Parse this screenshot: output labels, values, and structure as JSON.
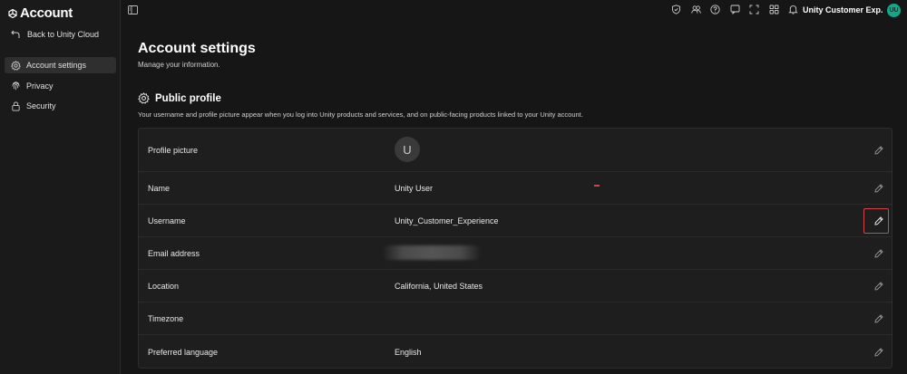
{
  "brand": {
    "title": "Account"
  },
  "sidebar": {
    "back_label": "Back to Unity Cloud",
    "items": [
      {
        "label": "Account settings",
        "icon": "gear-icon",
        "active": true
      },
      {
        "label": "Privacy",
        "icon": "fingerprint-icon",
        "active": false
      },
      {
        "label": "Security",
        "icon": "lock-icon",
        "active": false
      }
    ]
  },
  "topbar": {
    "icons": [
      "shield-icon",
      "people-icon",
      "help-icon",
      "chat-icon",
      "fullscreen-icon",
      "apps-grid-icon",
      "bell-icon"
    ],
    "org_name": "Unity Customer Exp...",
    "avatar_initials": "UU",
    "avatar_color": "#14a88a"
  },
  "page": {
    "title": "Account settings",
    "subtitle": "Manage your information."
  },
  "public_profile": {
    "title": "Public profile",
    "description": "Your username and profile picture appear when you log into Unity products and services, and on public-facing products linked to your Unity account.",
    "rows": [
      {
        "label": "Profile picture",
        "value": "",
        "avatar_letter": "U"
      },
      {
        "label": "Name",
        "value": "Unity User"
      },
      {
        "label": "Username",
        "value": "Unity_Customer_Experience"
      },
      {
        "label": "Email address",
        "value": ""
      },
      {
        "label": "Location",
        "value": "California, United States"
      },
      {
        "label": "Timezone",
        "value": ""
      },
      {
        "label": "Preferred language",
        "value": "English"
      }
    ]
  },
  "colors": {
    "highlight": "#d2464a",
    "background": "#161616",
    "card": "#1e1e1e"
  }
}
